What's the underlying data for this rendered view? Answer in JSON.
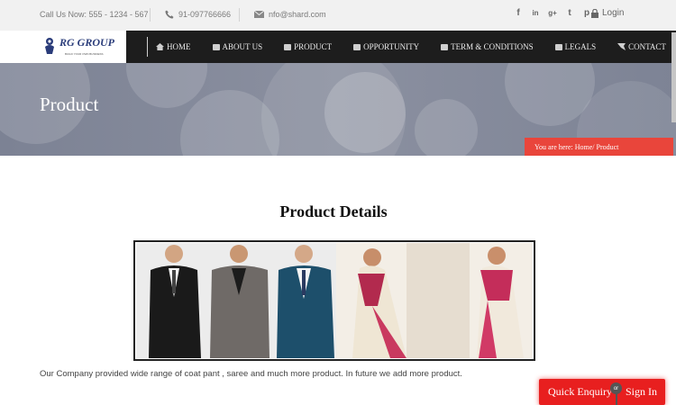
{
  "topbar": {
    "call_text": "Call Us Now: 555 - 1234 - 567",
    "phone": "91-097766666",
    "email": "nfo@shard.com",
    "social": [
      {
        "icon": "facebook-icon",
        "glyph": "f"
      },
      {
        "icon": "linkedin-icon",
        "glyph": "in"
      },
      {
        "icon": "google-plus-icon",
        "glyph": "g+"
      },
      {
        "icon": "twitter-icon",
        "glyph": "t"
      },
      {
        "icon": "pinterest-icon",
        "glyph": "p"
      }
    ],
    "login_label": "Login"
  },
  "logo": {
    "name": "RG GROUP",
    "tagline": "BUILD YOUR OWN BUSINESS"
  },
  "nav": {
    "items": [
      {
        "label": "HOME",
        "icon": "home-icon"
      },
      {
        "label": "ABOUT US",
        "icon": "about-icon"
      },
      {
        "label": "PRODUCT",
        "icon": "product-icon"
      },
      {
        "label": "OPPORTUNITY",
        "icon": "opportunity-icon"
      },
      {
        "label": "TERM & CONDITIONS",
        "icon": "terms-icon"
      },
      {
        "label": "LEGALS",
        "icon": "legals-icon"
      },
      {
        "label": "CONTACT",
        "icon": "contact-icon"
      }
    ]
  },
  "banner": {
    "title": "Product",
    "breadcrumb": "You are here:  Home/ Product"
  },
  "main": {
    "heading": "Product Details",
    "description": "Our Company provided wide range of coat pant , saree and much more product. In future we add more product."
  },
  "actions": {
    "enquiry": "Quick Enquiry",
    "or": "or",
    "signin": "Sign In"
  },
  "colors": {
    "accent_red": "#e9453b",
    "nav_bg": "#1d1d1d",
    "banner_bg": "#858a9b"
  }
}
